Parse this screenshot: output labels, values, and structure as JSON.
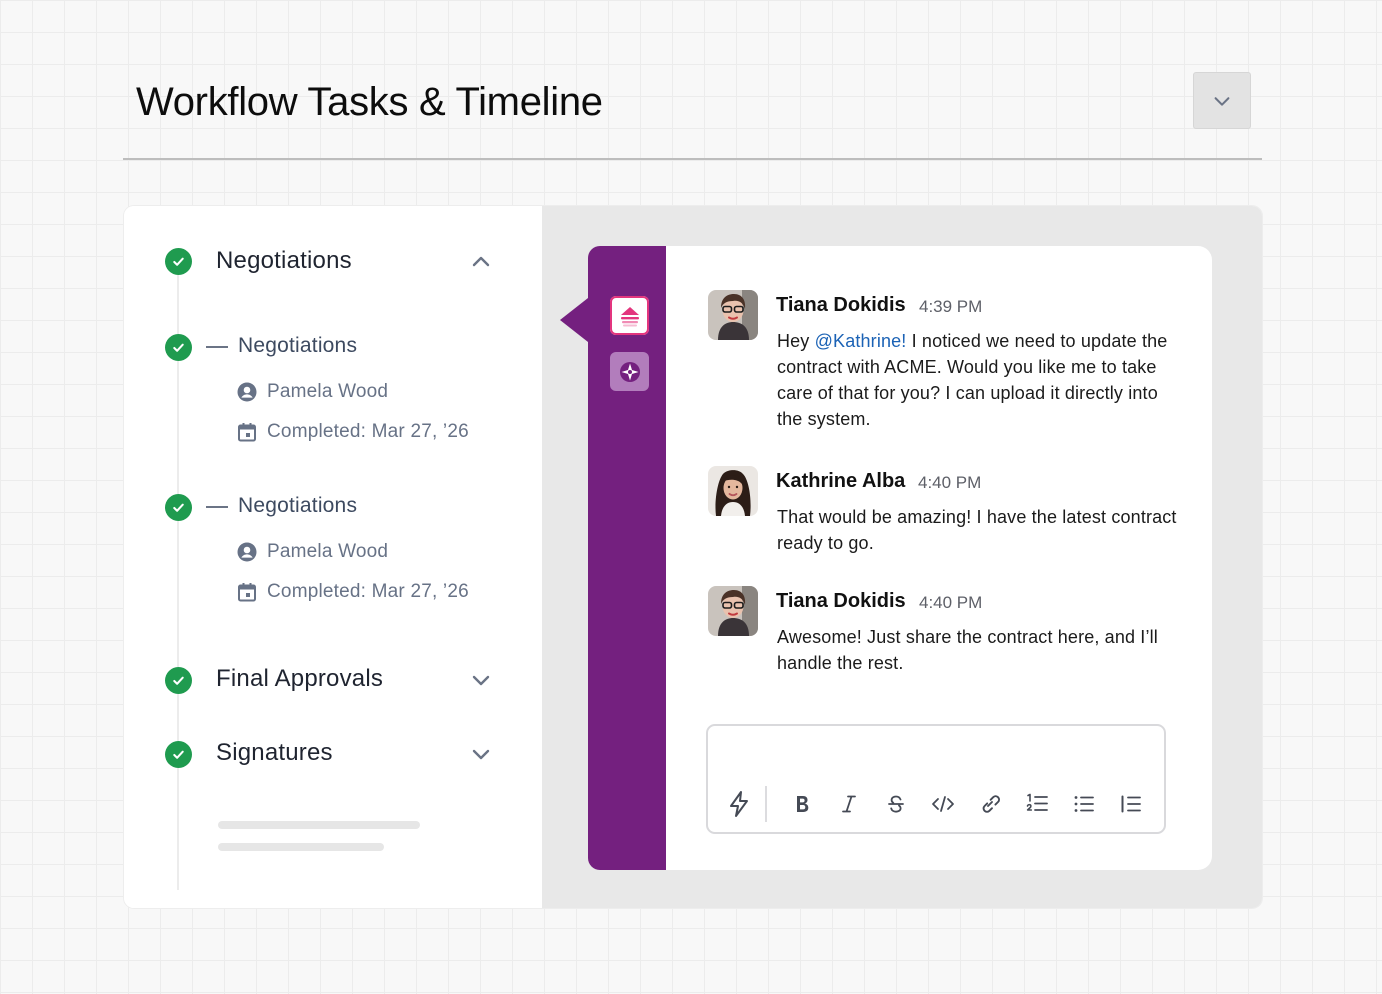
{
  "header": {
    "title": "Workflow Tasks & Timeline",
    "toggle_icon": "chevron-down-icon"
  },
  "tasks": {
    "stages": [
      {
        "label": "Negotiations",
        "status": "completed",
        "expanded": true
      },
      {
        "label": "Final Approvals",
        "status": "completed",
        "expanded": false
      },
      {
        "label": "Signatures",
        "status": "completed",
        "expanded": false
      }
    ],
    "subtasks": [
      {
        "label": "Negotiations",
        "assignee": "Pamela Wood",
        "completed": "Completed: Mar 27, ’26"
      },
      {
        "label": "Negotiations",
        "assignee": "Pamela Wood",
        "completed": "Completed: Mar 27, ’26"
      }
    ]
  },
  "rail": {
    "apps": [
      "layers-app-icon",
      "compass-app-icon"
    ],
    "color": "#74207f"
  },
  "chat": {
    "messages": [
      {
        "author": "Tiana Dokidis",
        "time": "4:39 PM",
        "text_before_mention": "Hey ",
        "mention": "@Kathrine!",
        "text_after_mention": " I noticed we need to update the contract with ACME. Would you like me to take care of that for you? I can upload it directly into the system."
      },
      {
        "author": "Kathrine Alba",
        "time": "4:40 PM",
        "text": "That would be amazing! I have the latest contract ready to go."
      },
      {
        "author": "Tiana Dokidis",
        "time": "4:40 PM",
        "text": "Awesome! Just share the contract here, and I’ll handle the rest."
      }
    ],
    "composer": {
      "value": "",
      "tools": [
        "shortcuts-icon",
        "bold-icon",
        "italic-icon",
        "strikethrough-icon",
        "code-icon",
        "link-icon",
        "ordered-list-icon",
        "bulleted-list-icon",
        "blockquote-icon"
      ]
    }
  },
  "colors": {
    "success": "#1f9b4f",
    "brand_purple": "#74207f",
    "mention": "#1b62b5"
  }
}
